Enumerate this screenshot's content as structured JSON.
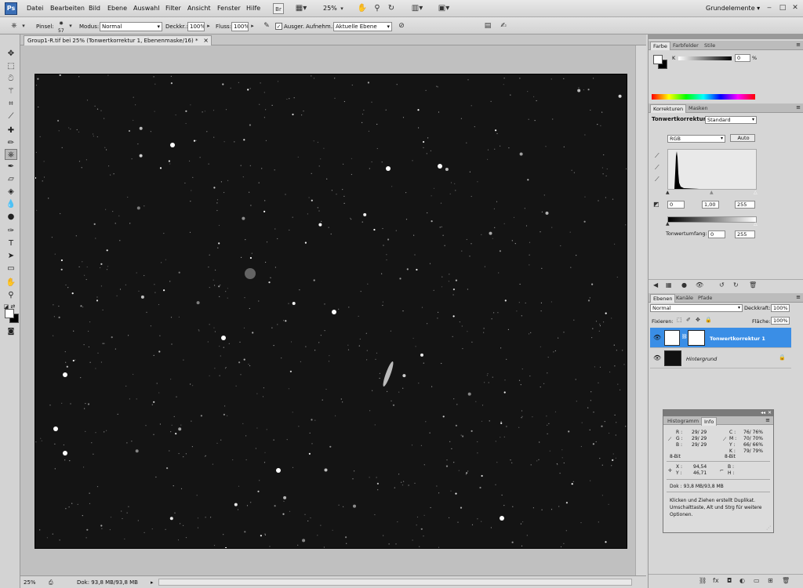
{
  "menubar": {
    "logo": "Ps",
    "items": [
      "Datei",
      "Bearbeiten",
      "Bild",
      "Ebene",
      "Auswahl",
      "Filter",
      "Ansicht",
      "Fenster",
      "Hilfe"
    ],
    "br_label": "Br",
    "zoom": "25%",
    "workspace": "Grundelemente",
    "workspace_arrow": "▾"
  },
  "options": {
    "brush_label": "Pinsel:",
    "brush_size": "57",
    "mode_label": "Modus:",
    "mode_value": "Normal",
    "opacity_label": "Deckkr.:",
    "opacity_value": "100%",
    "flow_label": "Fluss:",
    "flow_value": "100%",
    "aligned_label": "Ausger.",
    "sample_label": "Aufnehm.:",
    "sample_value": "Aktuelle Ebene"
  },
  "document": {
    "tab_title": "Group1-R.tif bei 25% (Tonwertkorrektur 1, Ebenenmaske/16) *",
    "close": "×"
  },
  "status": {
    "zoom": "25%",
    "doc": "Dok: 93,8 MB/93,8 MB"
  },
  "color_panel": {
    "tabs": [
      "Farbe",
      "Farbfelder",
      "Stile"
    ],
    "channel": "K",
    "value": "0",
    "unit": "%"
  },
  "adjustments_panel": {
    "tabs": [
      "Korrekturen",
      "Masken"
    ],
    "title": "Tonwertkorrektur",
    "preset": "Standard",
    "channel": "RGB",
    "auto_label": "Auto",
    "input_low": "0",
    "input_mid": "1,00",
    "input_high": "255",
    "output_label": "Tonwertumfang:",
    "output_low": "0",
    "output_high": "255"
  },
  "layers_panel": {
    "tabs": [
      "Ebenen",
      "Kanäle",
      "Pfade"
    ],
    "blend_mode": "Normal",
    "opacity_label": "Deckkraft:",
    "opacity_value": "100%",
    "lock_label": "Fixieren:",
    "fill_label": "Fläche:",
    "fill_value": "100%",
    "layers": [
      {
        "name": "Tonwertkorrektur 1",
        "selected": true
      },
      {
        "name": "Hintergrund",
        "selected": false
      }
    ]
  },
  "info_panel": {
    "tabs": [
      "Histogramm",
      "Info"
    ],
    "rgb_labels": [
      "R :",
      "G :",
      "B :"
    ],
    "rgb_values": [
      "29/  29",
      "29/  29",
      "29/  29"
    ],
    "cmyk_labels": [
      "C :",
      "M :",
      "Y :",
      "K :"
    ],
    "cmyk_values": [
      "76/  76%",
      "70/  70%",
      "66/  66%",
      "79/  79%"
    ],
    "bit_left": "8-Bit",
    "bit_right": "8-Bit",
    "xy_labels": [
      "X :",
      "Y :"
    ],
    "xy_values": [
      "94,54",
      "46,71"
    ],
    "bh_labels": [
      "B :",
      "H :"
    ],
    "doc": "Dok : 93,8 MB/93,8 MB",
    "hint": [
      "Klicken und Ziehen erstellt Duplikat.",
      "Umschalttaste, Alt und Strg für weitere",
      "Optionen."
    ]
  },
  "colors": {
    "selected_layer": "#3a8ee6",
    "canvas_bg": "#141414"
  }
}
